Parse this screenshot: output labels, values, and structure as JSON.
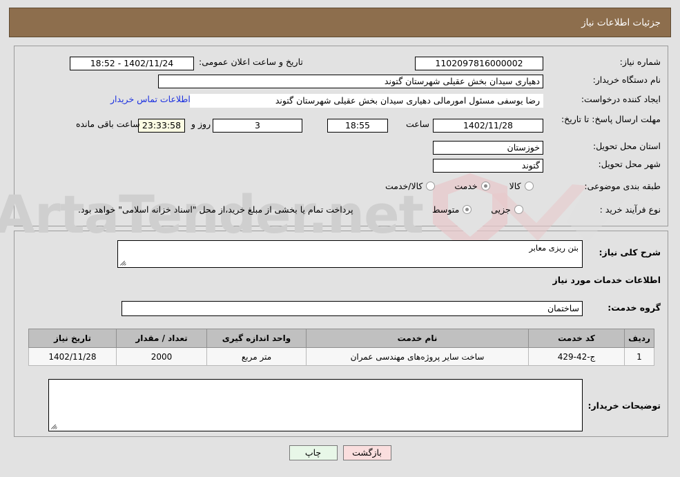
{
  "header": {
    "title": "جزئیات اطلاعات نیاز"
  },
  "watermark": {
    "text": "ArtaTender.net"
  },
  "form": {
    "need_number_label": "شماره نیاز:",
    "need_number_value": "1102097816000002",
    "public_announce_label": "تاریخ و ساعت اعلان عمومی:",
    "public_announce_value": "1402/11/24 - 18:52",
    "buyer_org_label": "نام دستگاه خریدار:",
    "buyer_org_value": "دهیاری سیدان بخش عقیلی شهرستان گتوند",
    "creator_label": "ایجاد کننده درخواست:",
    "creator_value": "رضا یوسفی مسئول امورمالی دهیاری سیدان بخش عقیلی شهرستان گتوند",
    "contact_link": "اطلاعات تماس خریدار",
    "deadline_label": "مهلت ارسال پاسخ: تا تاریخ:",
    "deadline_date": "1402/11/28",
    "deadline_hour_label": "ساعت",
    "deadline_hour": "18:55",
    "remaining_days": "3",
    "remaining_days_label": "روز و",
    "remaining_time": "23:33:58",
    "remaining_time_label": "ساعت باقی مانده",
    "province_label": "استان محل تحویل:",
    "province_value": "خوزستان",
    "city_label": "شهر محل تحویل:",
    "city_value": "گتوند",
    "category_label": "طبقه بندی موضوعی:",
    "category_options": [
      {
        "label": "کالا",
        "selected": false
      },
      {
        "label": "خدمت",
        "selected": true
      },
      {
        "label": "کالا/خدمت",
        "selected": false
      }
    ],
    "process_label": "نوع فرآیند خرید :",
    "process_options": [
      {
        "label": "جزیی",
        "selected": false
      },
      {
        "label": "متوسط",
        "selected": true
      }
    ],
    "process_note": "پرداخت تمام یا بخشی از مبلغ خرید،از محل \"اسناد خزانه اسلامی\" خواهد بود."
  },
  "details": {
    "general_desc_label": "شرح کلی نیاز:",
    "general_desc_value": "بتن ریزی معابر",
    "services_heading": "اطلاعات خدمات مورد نیاز",
    "service_group_label": "گروه خدمت:",
    "service_group_value": "ساختمان",
    "buyer_notes_label": "توضیحات خریدار:",
    "buyer_notes_value": ""
  },
  "table": {
    "columns": [
      "ردیف",
      "کد خدمت",
      "نام خدمت",
      "واحد اندازه گیری",
      "تعداد / مقدار",
      "تاریخ نیاز"
    ],
    "rows": [
      {
        "index": "1",
        "code": "ج-42-429",
        "name": "ساخت سایر پروژه‌های مهندسی عمران",
        "unit": "متر مربع",
        "quantity": "2000",
        "date": "1402/11/28"
      }
    ]
  },
  "footer": {
    "print_label": "چاپ",
    "back_label": "بازگشت"
  },
  "colors": {
    "header_bg": "#8d6e4d",
    "page_bg": "#e2e2e2",
    "link": "#1a2fe0",
    "table_header": "#c0c0c0",
    "print_button": "#e8f7e8",
    "back_button": "#fadede",
    "countdown_bg": "#fbfbe3"
  }
}
